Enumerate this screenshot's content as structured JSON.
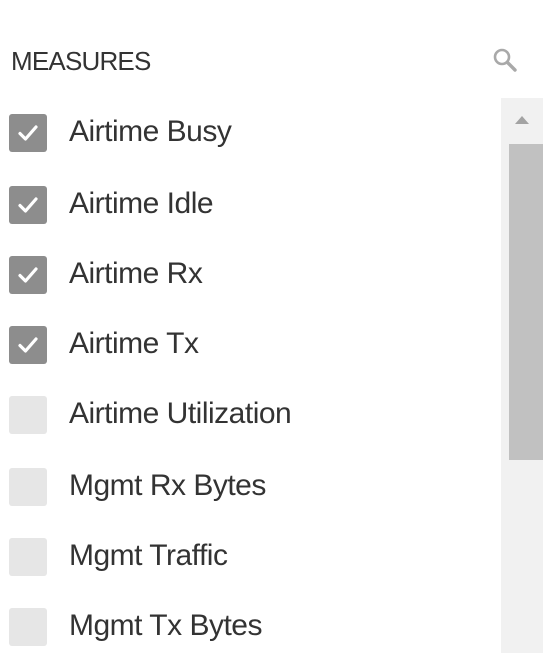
{
  "header": {
    "title": "MEASURES",
    "search_icon": "search-icon"
  },
  "measures": [
    {
      "label": "Airtime Busy",
      "checked": true
    },
    {
      "label": "Airtime Idle",
      "checked": true
    },
    {
      "label": "Airtime Rx",
      "checked": true
    },
    {
      "label": "Airtime Tx",
      "checked": true
    },
    {
      "label": "Airtime Utilization",
      "checked": false
    },
    {
      "label": "Mgmt Rx Bytes",
      "checked": false
    },
    {
      "label": "Mgmt Traffic",
      "checked": false
    },
    {
      "label": "Mgmt Tx Bytes",
      "checked": false
    }
  ],
  "colors": {
    "checked_box": "#8d8d8d",
    "unchecked_box": "#e6e6e6",
    "text": "#333333",
    "scroll_track": "#f1f1f1",
    "scroll_thumb": "#c1c1c1"
  }
}
